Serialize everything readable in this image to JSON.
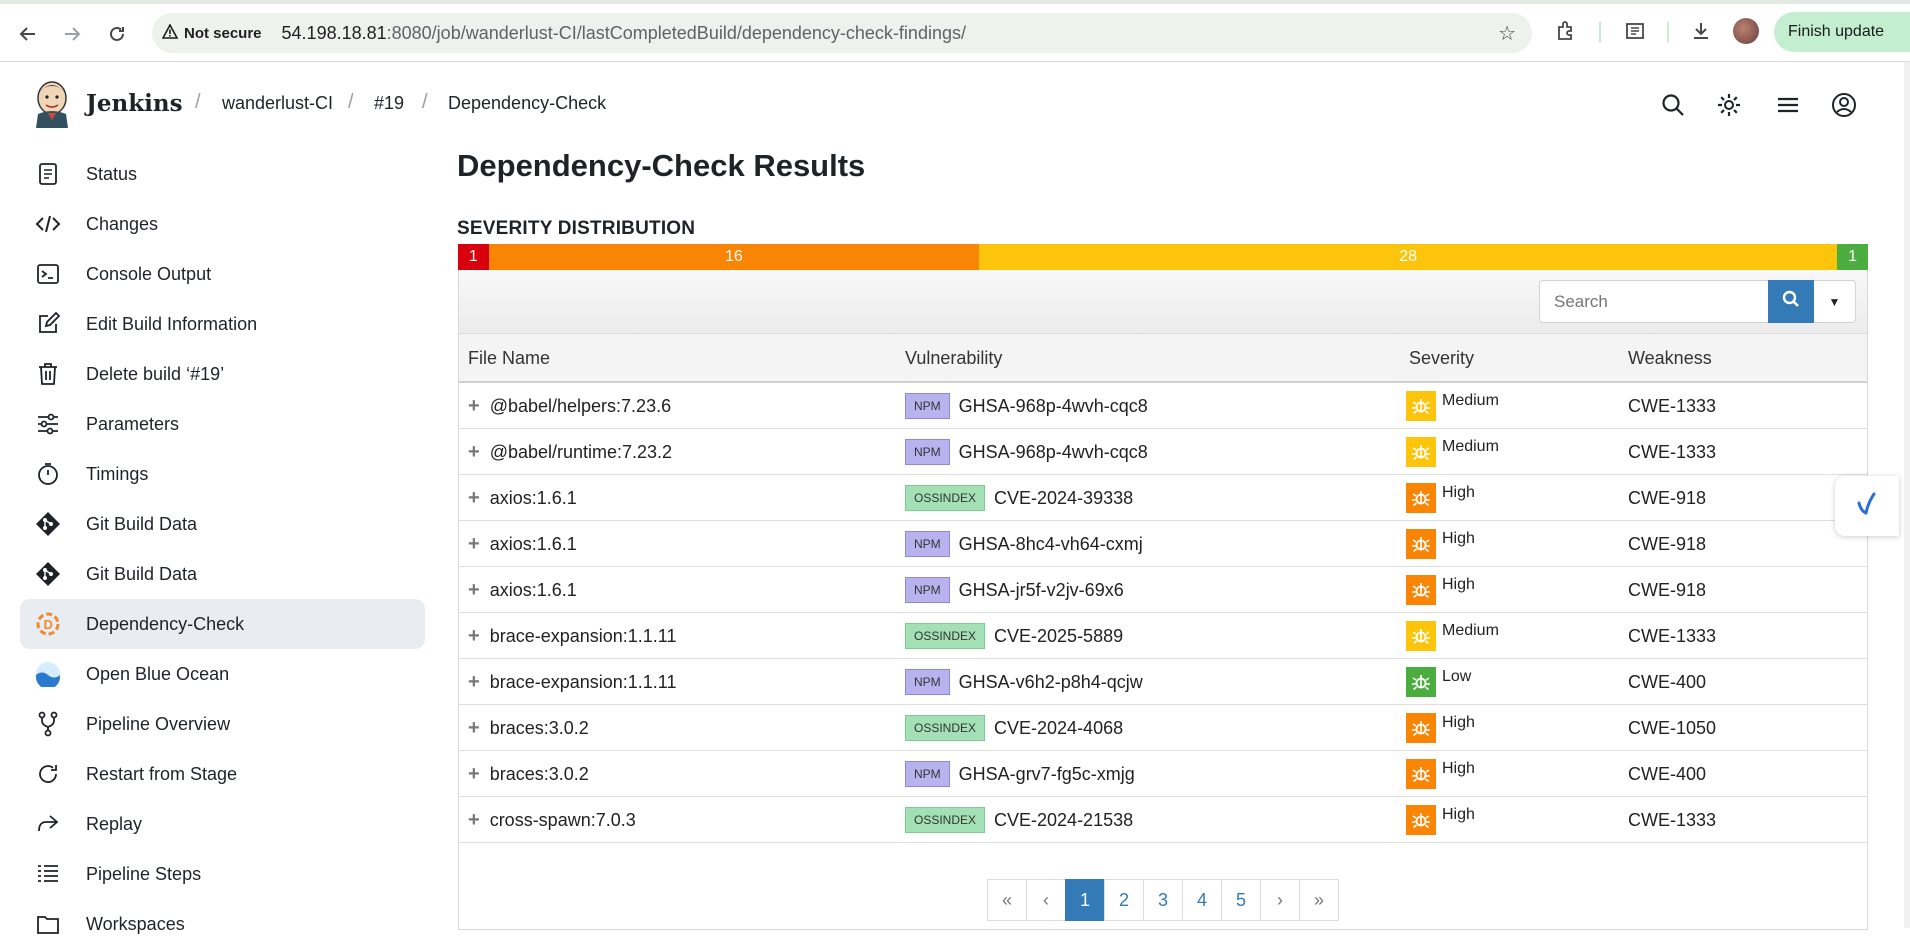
{
  "browser": {
    "not_secure": "Not secure",
    "url_host": "54.198.18.81",
    "url_rest": ":8080/job/wanderlust-CI/lastCompletedBuild/dependency-check-findings/",
    "finish_update": "Finish update"
  },
  "header": {
    "brand": "Jenkins",
    "breadcrumbs": [
      "wanderlust-CI",
      "#19",
      "Dependency-Check"
    ]
  },
  "sidebar": {
    "items": [
      {
        "label": "Status",
        "icon": "document-icon"
      },
      {
        "label": "Changes",
        "icon": "code-icon"
      },
      {
        "label": "Console Output",
        "icon": "terminal-icon"
      },
      {
        "label": "Edit Build Information",
        "icon": "edit-icon"
      },
      {
        "label": "Delete build ‘#19’",
        "icon": "trash-icon"
      },
      {
        "label": "Parameters",
        "icon": "sliders-icon"
      },
      {
        "label": "Timings",
        "icon": "stopwatch-icon"
      },
      {
        "label": "Git Build Data",
        "icon": "git-icon"
      },
      {
        "label": "Git Build Data",
        "icon": "git-icon"
      },
      {
        "label": "Dependency-Check",
        "icon": "dependency-check-icon"
      },
      {
        "label": "Open Blue Ocean",
        "icon": "blue-ocean-icon"
      },
      {
        "label": "Pipeline Overview",
        "icon": "branch-icon"
      },
      {
        "label": "Restart from Stage",
        "icon": "restart-icon"
      },
      {
        "label": "Replay",
        "icon": "replay-icon"
      },
      {
        "label": "Pipeline Steps",
        "icon": "list-icon"
      },
      {
        "label": "Workspaces",
        "icon": "folder-icon"
      }
    ]
  },
  "main": {
    "title": "Dependency-Check Results",
    "severity_title": "SEVERITY DISTRIBUTION",
    "severity": [
      {
        "label": "1",
        "count": 1,
        "color": "#d9000d"
      },
      {
        "label": "16",
        "count": 16,
        "color": "#fa8505"
      },
      {
        "label": "28",
        "count": 28,
        "color": "#fcc50c"
      },
      {
        "label": "1",
        "count": 1,
        "color": "#4bad3f"
      }
    ],
    "search_placeholder": "Search",
    "columns": [
      "File Name",
      "Vulnerability",
      "Severity",
      "Weakness"
    ],
    "rows": [
      {
        "file": "@babel/helpers:7.23.6",
        "source": "NPM",
        "vuln": "GHSA-968p-4wvh-cqc8",
        "severity": "Medium",
        "weakness": "CWE-1333"
      },
      {
        "file": "@babel/runtime:7.23.2",
        "source": "NPM",
        "vuln": "GHSA-968p-4wvh-cqc8",
        "severity": "Medium",
        "weakness": "CWE-1333"
      },
      {
        "file": "axios:1.6.1",
        "source": "OSSINDEX",
        "vuln": "CVE-2024-39338",
        "severity": "High",
        "weakness": "CWE-918"
      },
      {
        "file": "axios:1.6.1",
        "source": "NPM",
        "vuln": "GHSA-8hc4-vh64-cxmj",
        "severity": "High",
        "weakness": "CWE-918"
      },
      {
        "file": "axios:1.6.1",
        "source": "NPM",
        "vuln": "GHSA-jr5f-v2jv-69x6",
        "severity": "High",
        "weakness": "CWE-918"
      },
      {
        "file": "brace-expansion:1.1.11",
        "source": "OSSINDEX",
        "vuln": "CVE-2025-5889",
        "severity": "Medium",
        "weakness": "CWE-1333"
      },
      {
        "file": "brace-expansion:1.1.11",
        "source": "NPM",
        "vuln": "GHSA-v6h2-p8h4-qcjw",
        "severity": "Low",
        "weakness": "CWE-400"
      },
      {
        "file": "braces:3.0.2",
        "source": "OSSINDEX",
        "vuln": "CVE-2024-4068",
        "severity": "High",
        "weakness": "CWE-1050"
      },
      {
        "file": "braces:3.0.2",
        "source": "NPM",
        "vuln": "GHSA-grv7-fg5c-xmjg",
        "severity": "High",
        "weakness": "CWE-400"
      },
      {
        "file": "cross-spawn:7.0.3",
        "source": "OSSINDEX",
        "vuln": "CVE-2024-21538",
        "severity": "High",
        "weakness": "CWE-1333"
      }
    ],
    "severity_colors": {
      "High": "#fa8505",
      "Medium": "#fcc50c",
      "Low": "#4bad3f"
    },
    "pagination": [
      "«",
      "‹",
      "1",
      "2",
      "3",
      "4",
      "5",
      "›",
      "»"
    ],
    "current_page": "1"
  }
}
